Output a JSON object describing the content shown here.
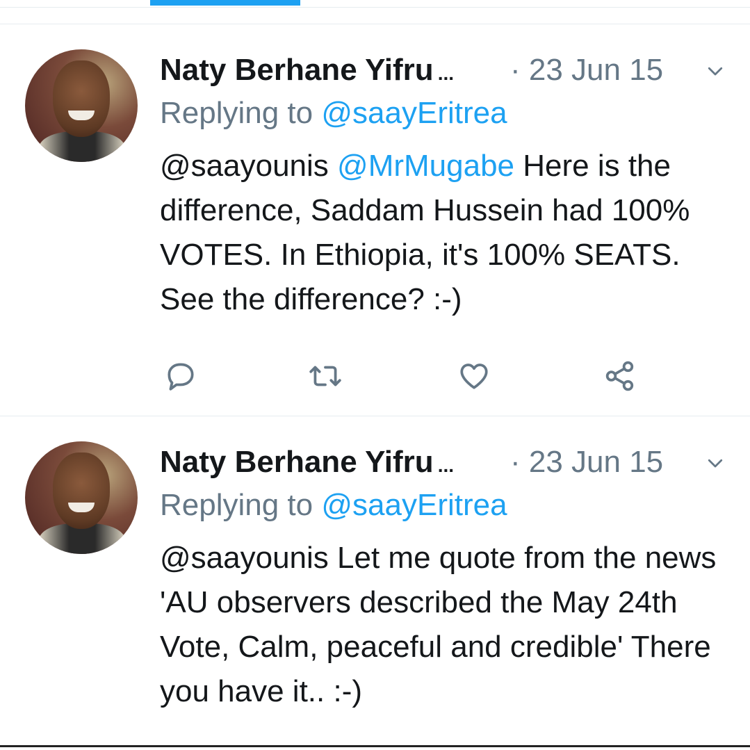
{
  "colors": {
    "accent": "#1da1f2",
    "muted": "#657786",
    "text": "#14171a",
    "divider": "#e6ecf0"
  },
  "tabs": {
    "active_index": 1
  },
  "tweets": [
    {
      "author": "Naty Berhane Yifru",
      "ellipsis": "...",
      "date": "· 23 Jun 15",
      "replying_prefix": "Replying to ",
      "replying_to": "@saayEritrea",
      "mention1": "@saayounis",
      "mention2": "@MrMugabe",
      "text": " Here is the difference, Saddam Hussein had 100% VOTES. In Ethiopia, it's 100% SEATS. See the difference? :-)",
      "actions": [
        "reply-icon",
        "retweet-icon",
        "like-icon",
        "share-icon"
      ]
    },
    {
      "author": "Naty Berhane Yifru",
      "ellipsis": "...",
      "date": "· 23 Jun 15",
      "replying_prefix": "Replying to ",
      "replying_to": "@saayEritrea",
      "mention1": "@saayounis",
      "text": " Let me quote from the news 'AU observers described the May 24th Vote, Calm, peaceful and credible' There you have it.. :-)"
    }
  ]
}
